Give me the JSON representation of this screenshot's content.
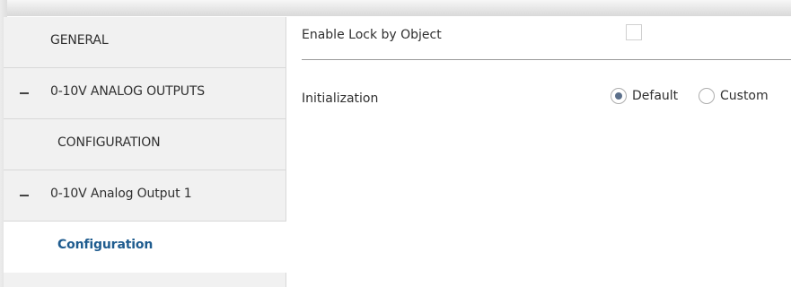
{
  "sidebar": {
    "items": [
      {
        "label": "GENERAL",
        "collapsible": false,
        "active": false
      },
      {
        "label": "0-10V ANALOG OUTPUTS",
        "collapsible": true,
        "active": false
      },
      {
        "label": "CONFIGURATION",
        "collapsible": false,
        "active": false
      },
      {
        "label": "0-10V Analog Output 1",
        "collapsible": true,
        "active": false
      },
      {
        "label": "Configuration",
        "collapsible": false,
        "active": true
      }
    ]
  },
  "main": {
    "lock_by_object": {
      "label": "Enable Lock by Object",
      "checked": false
    },
    "initialization": {
      "label": "Initialization",
      "options": [
        {
          "label": "Default",
          "selected": true
        },
        {
          "label": "Custom",
          "selected": false
        }
      ]
    }
  },
  "colors": {
    "sidebar_bg": "#f1f1f1",
    "active_item_text": "#1f5c8f",
    "radio_selected": "#5b6f8a"
  },
  "icons": {
    "collapse": "minus-icon",
    "radio": "radio-button-icon",
    "checkbox": "checkbox-icon"
  }
}
